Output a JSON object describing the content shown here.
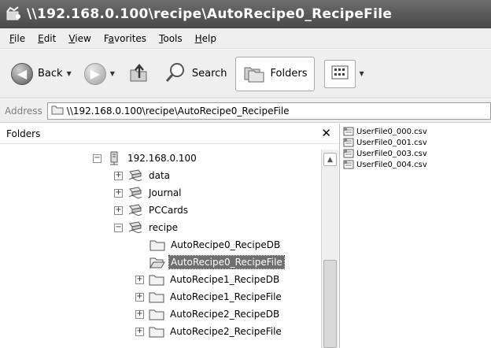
{
  "window": {
    "title": "\\\\192.168.0.100\\recipe\\AutoRecipe0_RecipeFile"
  },
  "menu": [
    {
      "prefix": "",
      "accel": "F",
      "rest": "ile"
    },
    {
      "prefix": "",
      "accel": "E",
      "rest": "dit"
    },
    {
      "prefix": "",
      "accel": "V",
      "rest": "iew"
    },
    {
      "prefix": "F",
      "accel": "a",
      "rest": "vorites"
    },
    {
      "prefix": "",
      "accel": "T",
      "rest": "ools"
    },
    {
      "prefix": "",
      "accel": "H",
      "rest": "elp"
    }
  ],
  "toolbar": {
    "back_label": "Back",
    "search_label": "Search",
    "folders_label": "Folders"
  },
  "address": {
    "label": "Address",
    "path": "\\\\192.168.0.100\\recipe\\AutoRecipe0_RecipeFile"
  },
  "folders_pane": {
    "title": "Folders",
    "tree": [
      {
        "label": "192.168.0.100",
        "expander": "−",
        "type": "server"
      },
      {
        "label": "data",
        "expander": "+",
        "type": "share"
      },
      {
        "label": "Journal",
        "expander": "+",
        "type": "share"
      },
      {
        "label": "PCCards",
        "expander": "+",
        "type": "share"
      },
      {
        "label": "recipe",
        "expander": "−",
        "type": "share"
      },
      {
        "label": "AutoRecipe0_RecipeDB",
        "expander": "",
        "type": "folder"
      },
      {
        "label": "AutoRecipe0_RecipeFile",
        "expander": "",
        "type": "folder-open",
        "selected": true
      },
      {
        "label": "AutoRecipe1_RecipeDB",
        "expander": "+",
        "type": "folder"
      },
      {
        "label": "AutoRecipe1_RecipeFile",
        "expander": "+",
        "type": "folder"
      },
      {
        "label": "AutoRecipe2_RecipeDB",
        "expander": "+",
        "type": "folder"
      },
      {
        "label": "AutoRecipe2_RecipeFile",
        "expander": "+",
        "type": "folder"
      }
    ]
  },
  "files": [
    "UserFile0_000.csv",
    "UserFile0_001.csv",
    "UserFile0_003.csv",
    "UserFile0_004.csv"
  ]
}
